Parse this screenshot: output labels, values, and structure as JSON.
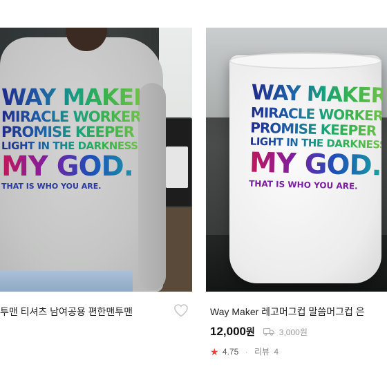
{
  "products": [
    {
      "title": "투맨 티셔츠 남여공용 편한맨투맨",
      "print": {
        "line1": "WAY MAKER",
        "line2": "MIRACLE WORKER",
        "line3": "PROMISE KEEPER",
        "line4": "LIGHT IN THE DARKNESS",
        "line5": "MY GOD.",
        "line6": "THAT IS WHO YOU ARE."
      },
      "icons": {
        "wishlist": "heart-outline-icon"
      }
    },
    {
      "title": "Way Maker 레고머그컵 말씀머그컵 은",
      "price": "12,000",
      "price_unit": "원",
      "shipping_fee": "3,000원",
      "rating": "4.75",
      "review_label": "리뷰",
      "review_count": "4",
      "print": {
        "line1": "WAY MAKER",
        "line2": "MIRACLE WORKER",
        "line3": "PROMISE KEEPER",
        "line4": "LIGHT IN THE DARKNESS",
        "line5": "MY GOD.",
        "line6": "THAT IS WHO YOU ARE."
      },
      "icons": {
        "shipping": "delivery-truck-icon",
        "rating": "star-icon"
      }
    }
  ],
  "colors": {
    "star": "#e8433a",
    "muted": "#999999",
    "text": "#222222"
  }
}
